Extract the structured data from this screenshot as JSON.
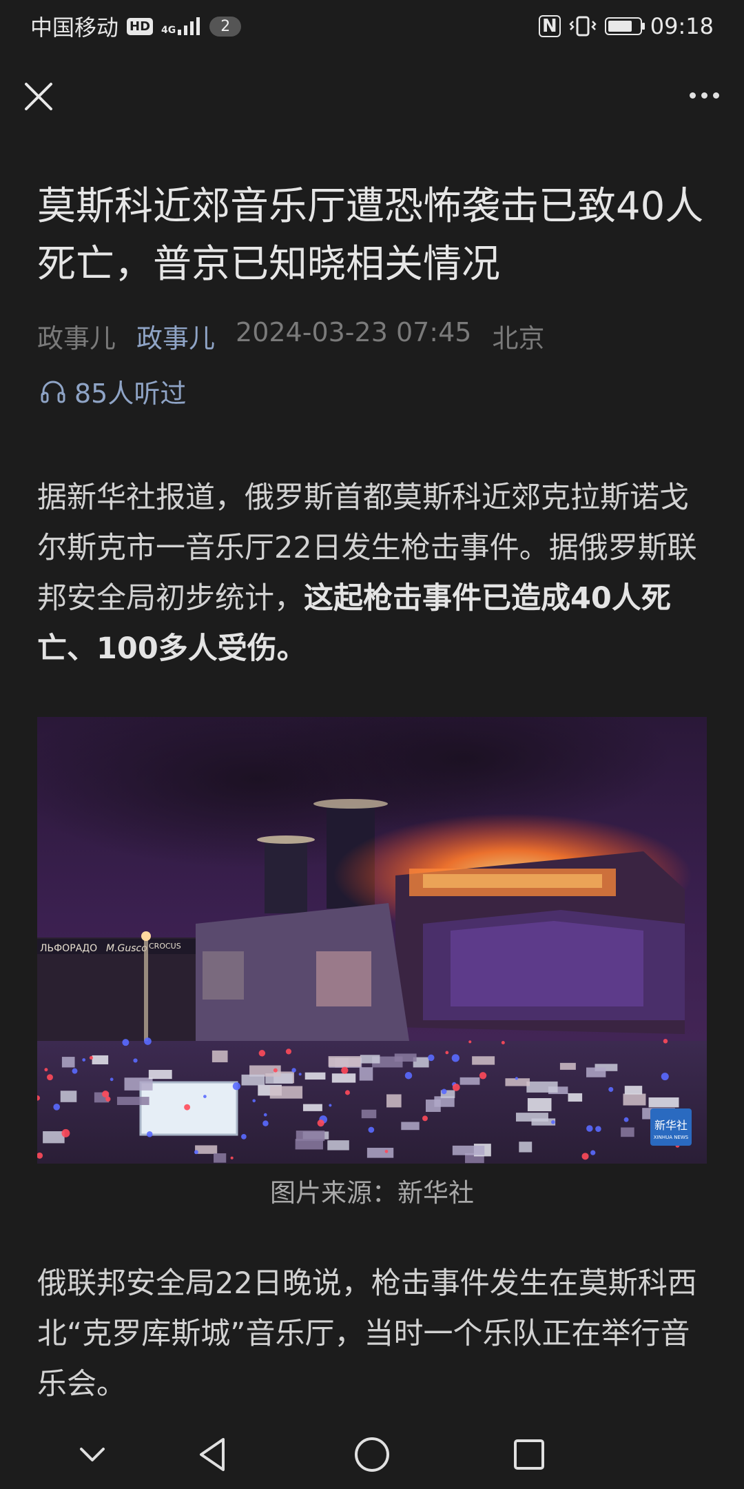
{
  "status_bar": {
    "carrier": "中国移动",
    "hd": "HD",
    "network": "4G",
    "sim_count": "2",
    "nfc": "N",
    "battery_level": 0.8,
    "time": "09:18"
  },
  "toolbar": {
    "close_icon": "close-icon",
    "more_icon": "more-icon"
  },
  "article": {
    "title": "莫斯科近郊音乐厅遭恐怖袭击已致40人死亡，普京已知晓相关情况",
    "source": "政事儿",
    "author": "政事儿",
    "datetime": "2024-03-23 07:45",
    "location": "北京",
    "listen_count": "85人听过",
    "paragraph1_normal": "据新华社报道，俄罗斯首都莫斯科近郊克拉斯诺戈尔斯克市一音乐厅22日发生枪击事件。据俄罗斯联邦安全局初步统计，",
    "paragraph1_bold": "这起枪击事件已造成40人死亡、100多人受伤。",
    "image_caption": "图片来源：新华社",
    "paragraph2": "俄联邦安全局22日晚说，枪击事件发生在莫斯科西北“克罗库斯城”音乐厅，当时一个乐队正在举行音乐会。"
  },
  "photo": {
    "signs": [
      "ЛЬФОРАДО",
      "M.Gusco",
      "CROCUS"
    ],
    "watermark": "新华社",
    "watermark_sub": "XINHUA NEWS"
  },
  "nav_bar": {
    "icons": [
      "collapse-icon",
      "back-icon",
      "home-icon",
      "recents-icon"
    ]
  }
}
